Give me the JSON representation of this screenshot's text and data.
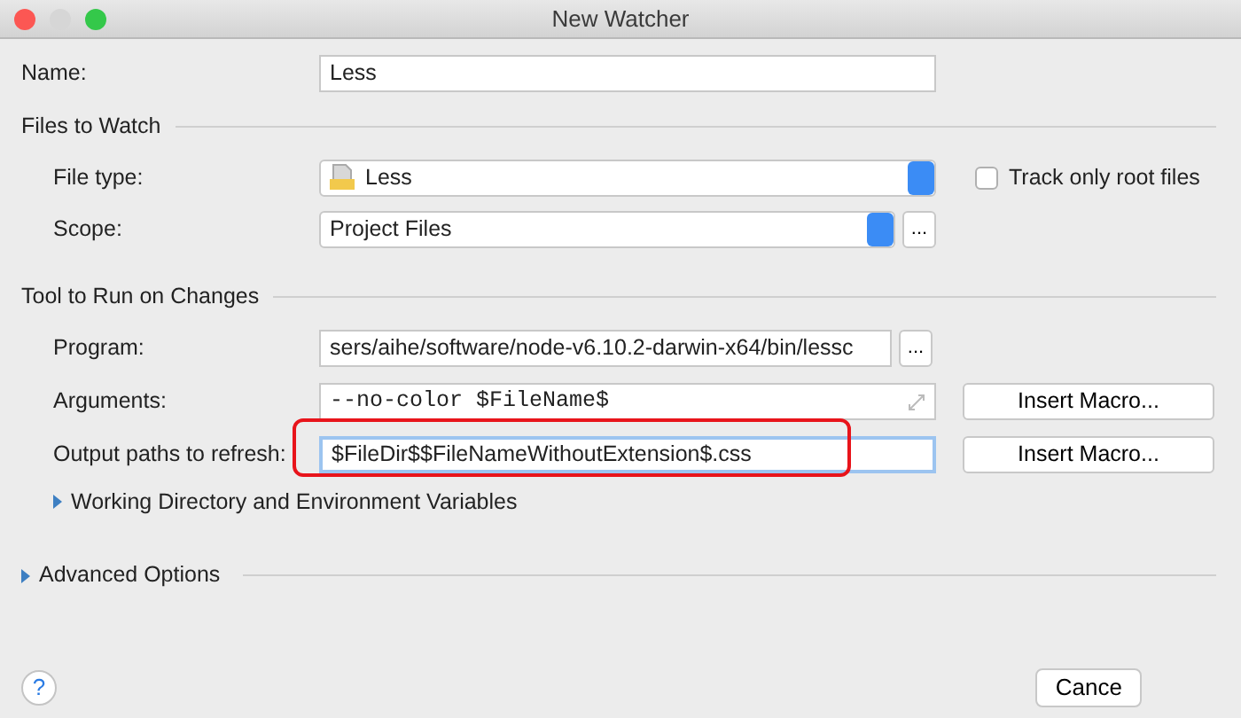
{
  "window": {
    "title": "New Watcher"
  },
  "name": {
    "label": "Name:",
    "value": "Less"
  },
  "files_to_watch": {
    "title": "Files to Watch",
    "file_type": {
      "label": "File type:",
      "value": "Less"
    },
    "track_only_root": {
      "label": "Track only root files",
      "checked": false
    },
    "scope": {
      "label": "Scope:",
      "value": "Project Files",
      "browse": "..."
    }
  },
  "tool": {
    "title": "Tool to Run on Changes",
    "program": {
      "label": "Program:",
      "value": "sers/aihe/software/node-v6.10.2-darwin-x64/bin/lessc",
      "browse": "..."
    },
    "arguments": {
      "label": "Arguments:",
      "value": "--no-color $FileName$",
      "button": "Insert Macro..."
    },
    "output_paths": {
      "label": "Output paths to refresh:",
      "value": "$FileDir$$FileNameWithoutExtension$.css",
      "button": "Insert Macro...",
      "focused": true,
      "highlighted": true
    }
  },
  "working_directory": {
    "label": "Working Directory and Environment Variables",
    "expanded": false
  },
  "advanced_options": {
    "label": "Advanced Options",
    "expanded": false
  },
  "footer": {
    "help": "?",
    "buttons": [
      "Cance"
    ]
  }
}
